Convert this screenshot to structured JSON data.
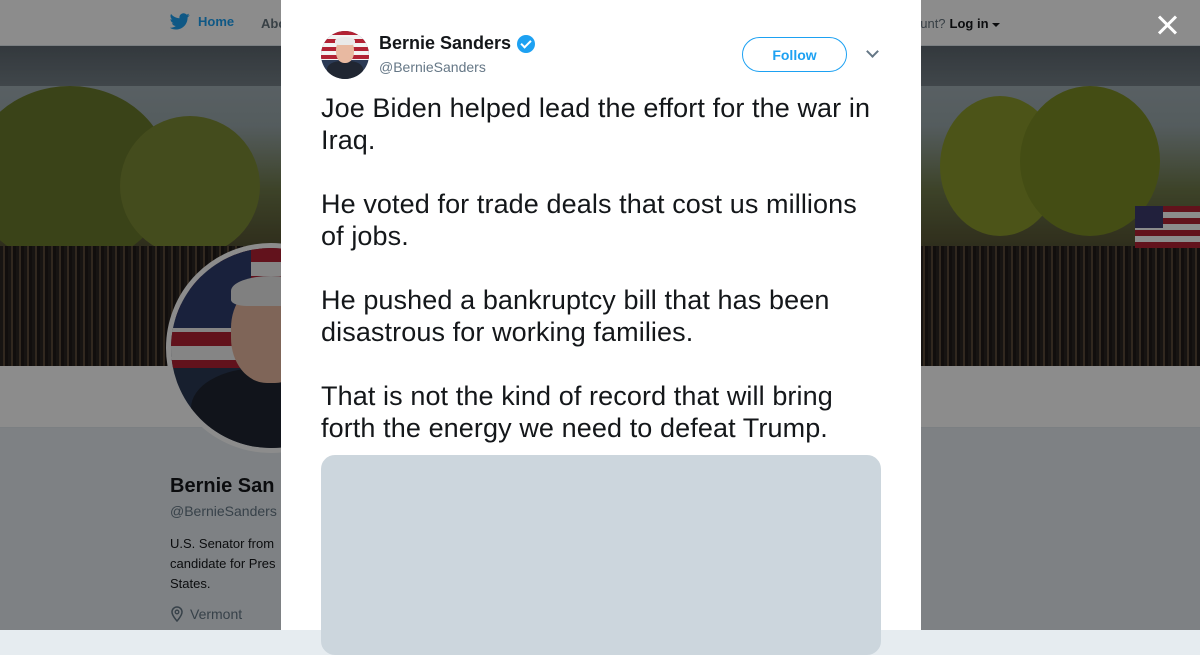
{
  "background": {
    "nav": {
      "home_label": "Home",
      "about_label": "Abo",
      "account_prompt": "ccount?",
      "login_label": "Log in"
    },
    "profile": {
      "name": "Bernie San",
      "handle": "@BernieSanders",
      "bio": "U.S. Senator from candidate for Pres States.",
      "location": "Vermont"
    }
  },
  "tweet": {
    "author_name": "Bernie Sanders",
    "author_handle": "@BernieSanders",
    "follow_label": "Follow",
    "paragraphs": [
      "Joe Biden helped lead the effort for the war in Iraq.",
      "He voted for trade deals that cost us millions of jobs.",
      "He pushed a bankruptcy bill that has been disastrous for working families.",
      "That is not the kind of record that will bring forth the energy we need to defeat Trump."
    ]
  },
  "icons": {
    "twitter_bird": "twitter-bird-icon",
    "verified": "verified-badge-icon",
    "close": "close-icon",
    "location": "location-pin-icon",
    "chevron": "chevron-down-icon"
  },
  "colors": {
    "accent": "#1da1f2",
    "text": "#14171a",
    "muted": "#657786",
    "media_placeholder": "#ccd6dd"
  }
}
